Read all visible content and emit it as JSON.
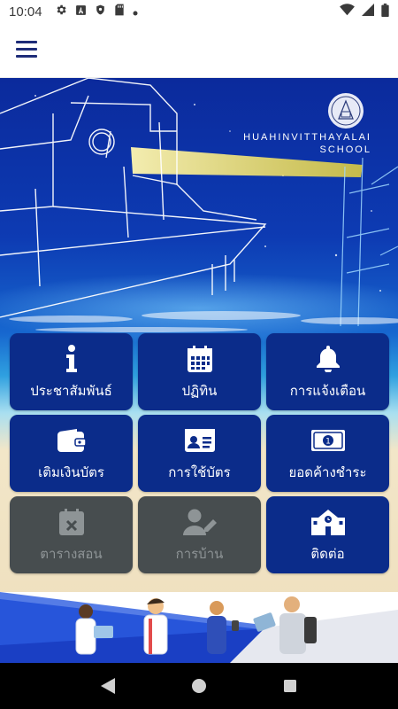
{
  "status_bar": {
    "time": "10:04",
    "icons": [
      "gear-icon",
      "a-icon",
      "shield-icon",
      "sd-card-icon",
      "dot-icon"
    ],
    "right_icons": [
      "wifi-icon",
      "signal-icon",
      "battery-icon"
    ]
  },
  "app_bar": {
    "menu_icon": "hamburger-menu-icon"
  },
  "hero": {
    "school_line1": "HUAHINVITTHAYALAI",
    "school_line2": "SCHOOL"
  },
  "menu": {
    "items": [
      {
        "label": "ประชาสัมพันธ์",
        "icon": "info-icon",
        "enabled": true
      },
      {
        "label": "ปฏิทิน",
        "icon": "calendar-icon",
        "enabled": true
      },
      {
        "label": "การแจ้งเตือน",
        "icon": "bell-icon",
        "enabled": true
      },
      {
        "label": "เติมเงินบัตร",
        "icon": "wallet-icon",
        "enabled": true
      },
      {
        "label": "การใช้บัตร",
        "icon": "id-card-icon",
        "enabled": true
      },
      {
        "label": "ยอดค้างชำระ",
        "icon": "money-bill-icon",
        "enabled": true
      },
      {
        "label": "ตารางสอน",
        "icon": "calendar-x-icon",
        "enabled": false
      },
      {
        "label": "การบ้าน",
        "icon": "user-edit-icon",
        "enabled": false
      },
      {
        "label": "ติดต่อ",
        "icon": "school-building-icon",
        "enabled": true
      }
    ]
  },
  "colors": {
    "tile_blue": "#0b2c8a",
    "tile_gray": "#474d4f",
    "app_accent": "#1e2c78"
  },
  "nav_bar": {
    "back": "back-icon",
    "home": "home-icon",
    "recents": "recents-icon"
  }
}
